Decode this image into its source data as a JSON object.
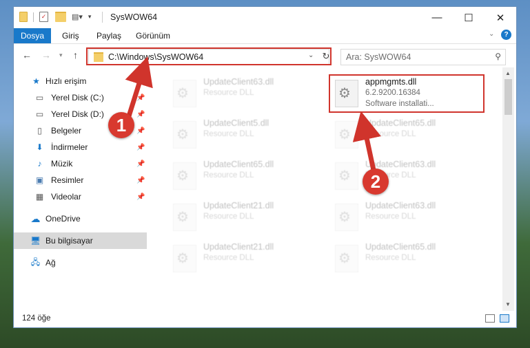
{
  "window": {
    "title": "SysWOW64",
    "minimize_glyph": "—",
    "maximize_glyph": "☐",
    "close_glyph": "✕"
  },
  "ribbon": {
    "tabs": [
      "Dosya",
      "Giriş",
      "Paylaş",
      "Görünüm"
    ],
    "help_glyph": "?"
  },
  "address": {
    "path": "C:\\Windows\\SysWOW64"
  },
  "search": {
    "placeholder": "Ara: SysWOW64"
  },
  "sidebar": {
    "items": [
      {
        "label": "Hızlı erişim",
        "icon": "star-icon"
      },
      {
        "label": "Yerel Disk (C:)",
        "icon": "drive-icon"
      },
      {
        "label": "Yerel Disk (D:)",
        "icon": "drive-icon"
      },
      {
        "label": "Belgeler",
        "icon": "documents-icon"
      },
      {
        "label": "İndirmeler",
        "icon": "download-icon"
      },
      {
        "label": "Müzik",
        "icon": "music-icon"
      },
      {
        "label": "Resimler",
        "icon": "pictures-icon"
      },
      {
        "label": "Videolar",
        "icon": "videos-icon"
      },
      {
        "label": "OneDrive",
        "icon": "cloud-icon"
      },
      {
        "label": "Bu bilgisayar",
        "icon": "computer-icon"
      },
      {
        "label": "Ağ",
        "icon": "network-icon"
      }
    ]
  },
  "files": {
    "highlighted": {
      "name": "appmgmts.dll",
      "version": "6.2.9200.16384",
      "description": "Software installati..."
    },
    "left": [
      {
        "name": "UpdateClient63.dll",
        "desc": "Resource DLL"
      },
      {
        "name": "UpdateClient5.dll",
        "desc": "Resource DLL"
      },
      {
        "name": "UpdateClient65.dll",
        "desc": "Resource DLL"
      },
      {
        "name": "UpdateClient21.dll",
        "desc": "Resource DLL"
      },
      {
        "name": "UpdateClient21.dll",
        "desc": "Resource DLL"
      }
    ],
    "right": [
      {
        "name": "UpdateClient65.dll",
        "desc": "Resource DLL"
      },
      {
        "name": "UpdateClient63.dll",
        "desc": "Resource DLL"
      },
      {
        "name": "UpdateClient63.dll",
        "desc": "Resource DLL"
      },
      {
        "name": "UpdateClient65.dll",
        "desc": "Resource DLL"
      }
    ]
  },
  "status": {
    "count": "124 öğe"
  },
  "annotations": {
    "step1": "1",
    "step2": "2",
    "color": "#d0342c"
  }
}
